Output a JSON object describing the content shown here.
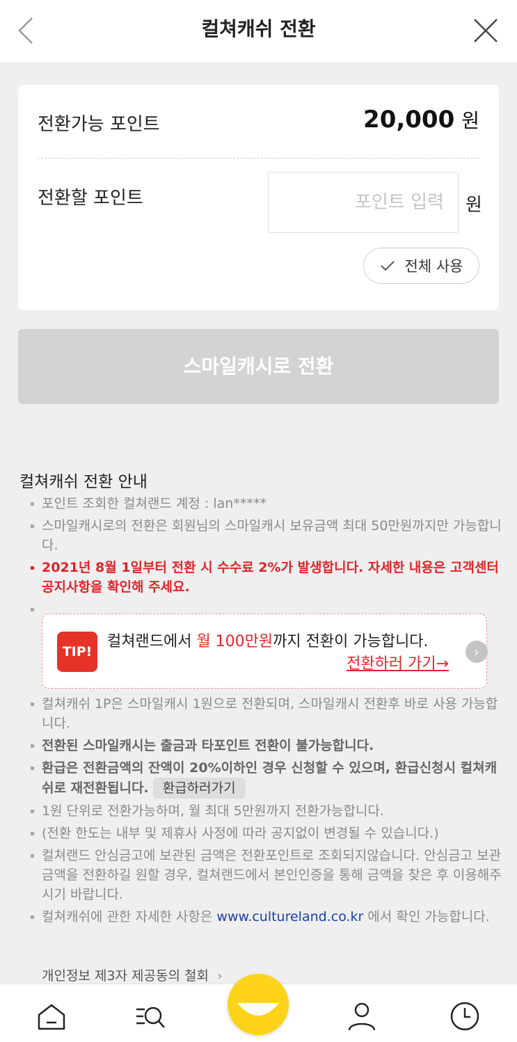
{
  "header": {
    "title": "컬쳐캐쉬 전환"
  },
  "card": {
    "available_label": "전환가능 포인트",
    "available_value": "20,000",
    "available_unit": "원",
    "convert_label": "전환할 포인트",
    "input_placeholder": "포인트 입력",
    "input_unit": "원",
    "use_all_label": "전체 사용"
  },
  "convert_button": "스마일캐시로 전환",
  "guide": {
    "title": "컬쳐캐쉬 전환 안내",
    "items": [
      "포인트 조회한 컬쳐랜드 계정 : lan*****",
      "스마일캐시로의 전환은 회원님의 스마일캐시 보유금액 최대 50만원까지만 가능합니다.",
      "2021년 8월 1일부터 전환 시 수수료 2%가 발생합니다. 자세한 내용은 고객센터 공지사항을 확인해 주세요.",
      "컬쳐캐쉬 1P은 스마일캐시 1원으로 전환되며, 스마일캐시 전환후 바로 사용 가능합니다.",
      "전환된 스마일캐시는 출금과 타포인트 전환이 불가능합니다.",
      "환급은 전환금액의 잔액이 20%이하인 경우 신청할 수 있으며, 환급신청시 컬쳐캐쉬로 재전환됩니다.",
      "1원 단위로 전환가능하며, 월 최대 5만원까지 전환가능합니다.",
      "(전환 한도는 내부 및 제휴사 사정에 따라 공지없이 변경될 수 있습니다.)",
      "컬쳐랜드 안심금고에 보관된 금액은 전환포인트로 조회되지않습니다. 안심금고 보관금액을 전환하길 원할 경우, 컬쳐랜드에서 본인인증을 통해 금액을 찾은 후 이용해주시기 바랍니다.",
      "컬쳐캐쉬에 관한 자세한 사항은",
      "에서 확인 가능합니다."
    ],
    "refund_button": "환급하러가기",
    "site_link": "www.cultureland.co.kr"
  },
  "tip": {
    "badge": "TIP!",
    "text_before": "컬쳐랜드에서 ",
    "text_highlight": "월 100만원",
    "text_after": "까지 전환이 가능합니다.",
    "link": "전환하러 가기→"
  },
  "privacy_link": "개인정보 제3자 제공동의 철회",
  "tabbar": {
    "icons": [
      "home-icon",
      "search-menu-icon",
      "smile-icon",
      "my-page-icon",
      "recent-icon"
    ]
  }
}
